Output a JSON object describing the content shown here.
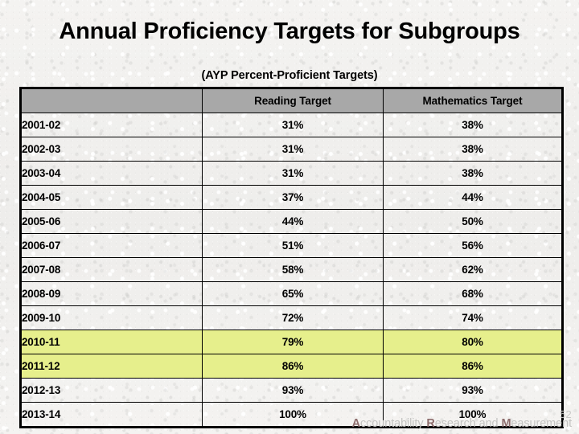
{
  "slide": {
    "title": "Annual Proficiency Targets for Subgroups",
    "subtitle": "(AYP Percent-Proficient Targets)",
    "page_number": "52",
    "background_color": "#f3f2f0"
  },
  "table": {
    "header_background": "#a8a8a8",
    "highlight_color": "#e6ef8c",
    "border_color": "#000000",
    "columns": [
      "",
      "Reading Target",
      "Mathematics Target"
    ],
    "rows": [
      {
        "year": "2001-02",
        "reading": "31%",
        "mathematics": "38%",
        "highlighted": false
      },
      {
        "year": "2002-03",
        "reading": "31%",
        "mathematics": "38%",
        "highlighted": false
      },
      {
        "year": "2003-04",
        "reading": "31%",
        "mathematics": "38%",
        "highlighted": false
      },
      {
        "year": "2004-05",
        "reading": "37%",
        "mathematics": "44%",
        "highlighted": false
      },
      {
        "year": "2005-06",
        "reading": "44%",
        "mathematics": "50%",
        "highlighted": false
      },
      {
        "year": "2006-07",
        "reading": "51%",
        "mathematics": "56%",
        "highlighted": false
      },
      {
        "year": "2007-08",
        "reading": "58%",
        "mathematics": "62%",
        "highlighted": false
      },
      {
        "year": "2008-09",
        "reading": "65%",
        "mathematics": "68%",
        "highlighted": false
      },
      {
        "year": "2009-10",
        "reading": "72%",
        "mathematics": "74%",
        "highlighted": false
      },
      {
        "year": "2010-11",
        "reading": "79%",
        "mathematics": "80%",
        "highlighted": true
      },
      {
        "year": "2011-12",
        "reading": "86%",
        "mathematics": "86%",
        "highlighted": true
      },
      {
        "year": "2012-13",
        "reading": "93%",
        "mathematics": "93%",
        "highlighted": false
      },
      {
        "year": "2013-14",
        "reading": "100%",
        "mathematics": "100%",
        "highlighted": false
      }
    ]
  },
  "footer": {
    "credit_parts": [
      {
        "text": "A",
        "emphasis": true
      },
      {
        "text": "ccountability ",
        "emphasis": false
      },
      {
        "text": "R",
        "emphasis": true
      },
      {
        "text": "esearch and ",
        "emphasis": false
      },
      {
        "text": "M",
        "emphasis": true
      },
      {
        "text": "easurement",
        "emphasis": false
      }
    ],
    "credit_plain": "Accountability Research and Measurement",
    "accent_color": "#8d6d6d",
    "text_color": "#c4c4c2"
  }
}
